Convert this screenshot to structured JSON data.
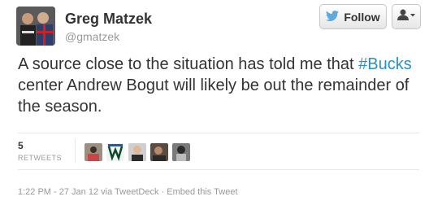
{
  "user": {
    "name": "Greg Matzek",
    "handle": "@gmatzek"
  },
  "follow": {
    "label": "Follow"
  },
  "tweet": {
    "before": "A source close to the situation has told me that ",
    "hashtag": "#Bucks",
    "after": " center Andrew Bogut will likely be out the remainder of the season."
  },
  "stats": {
    "count": "5",
    "label": "RETWEETS"
  },
  "footer": {
    "timestamp": "1:22 PM - 27 Jan 12",
    "via_prefix": "via ",
    "client": "TweetDeck",
    "separator": "·",
    "embed": "Embed this Tweet"
  },
  "colors": {
    "link": "#2a91c6",
    "bird": "#5ea9dd"
  },
  "icons": [
    "twitter-bird-icon",
    "user-dropdown-icon"
  ]
}
